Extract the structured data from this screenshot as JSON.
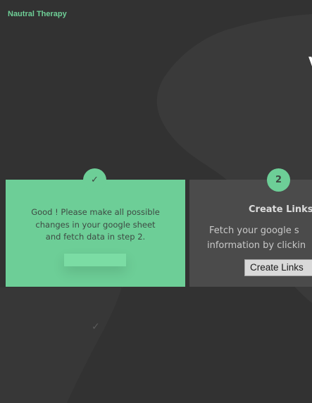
{
  "brand": {
    "name": "Nautral Therapy"
  },
  "edge_glyph": "V",
  "steps": [
    {
      "marker": "✓",
      "marker_icon": "check-icon",
      "message_line1": "Good ! Please make all possible",
      "message_line2": "changes in your google sheet",
      "message_line3": "and fetch data in step 2."
    },
    {
      "marker": "2",
      "title": "Create Links",
      "description_line1": "Fetch your google s",
      "description_line2": "information by clickin",
      "button_label": "Create Links"
    }
  ],
  "ghost_check": "✓",
  "colors": {
    "background": "#323232",
    "accent": "#6dce97",
    "card_inactive": "#4b4b4b",
    "brand_text": "#6fcf97"
  }
}
